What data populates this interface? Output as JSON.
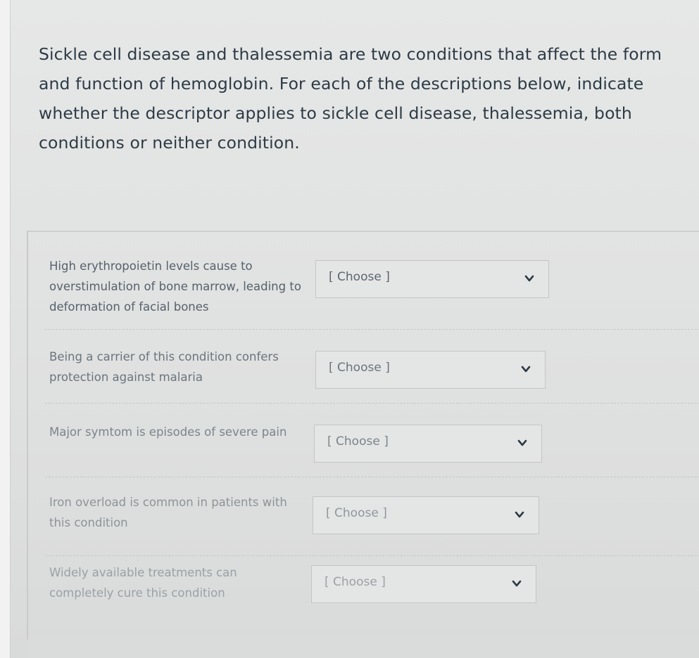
{
  "question": {
    "text": "Sickle cell disease and thalessemia are two conditions that affect the form and function of hemoglobin.  For each of the descriptions below, indicate whether the descriptor applies to sickle cell disease, thalessemia, both conditions or neither condition."
  },
  "answers": [
    {
      "label": "High erythropoietin levels cause to overstimulation of bone marrow, leading to deformation of facial bones",
      "selected": "[ Choose ]"
    },
    {
      "label": "Being a carrier of this condition confers protection against malaria",
      "selected": "[ Choose ]"
    },
    {
      "label": "Major symtom is episodes of severe pain",
      "selected": "[ Choose ]"
    },
    {
      "label": "Iron overload is common in patients with this condition",
      "selected": "[ Choose ]"
    },
    {
      "label": "Widely available treatments can completely cure this condition",
      "selected": "[ Choose ]"
    }
  ],
  "icons": {
    "select_arrow": "chevron-down-icon"
  },
  "colors": {
    "question_text": "#2d3b45",
    "label_text_strong": "#4a5560",
    "label_text_faded": "#8d9499",
    "chevron": "#2d3b45"
  }
}
